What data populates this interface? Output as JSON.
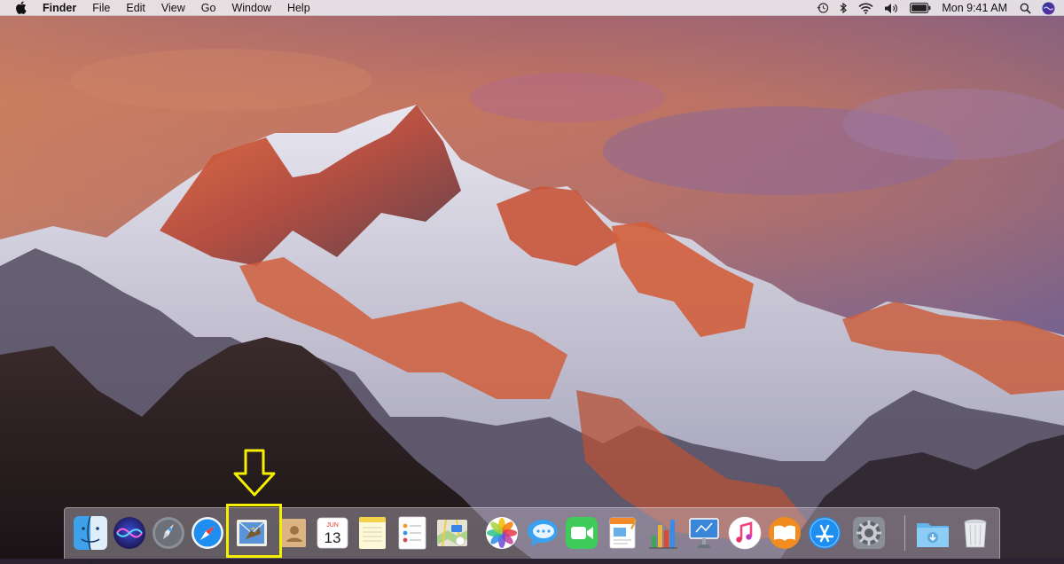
{
  "menubar": {
    "apple_menu": "apple-logo-icon",
    "app_name": "Finder",
    "menus": [
      "File",
      "Edit",
      "View",
      "Go",
      "Window",
      "Help"
    ],
    "status_icons": [
      "time-machine-icon",
      "bluetooth-icon",
      "wifi-icon",
      "volume-icon",
      "battery-icon"
    ],
    "clock": "Mon 9:41 AM",
    "spotlight": "search-icon",
    "siri": "siri-icon"
  },
  "wallpaper": {
    "description_colors": {
      "sky_top": "#a86a6e",
      "sky_mid": "#c47a63",
      "dusk_purple": "#6f5a87",
      "rock_glow": "#e0673a"
    }
  },
  "dock": {
    "items": [
      {
        "name": "Finder",
        "icon": "finder-icon",
        "running": true
      },
      {
        "name": "Siri",
        "icon": "siri-icon",
        "running": false
      },
      {
        "name": "Launchpad",
        "icon": "launchpad-icon",
        "running": false
      },
      {
        "name": "Safari",
        "icon": "safari-icon",
        "running": false
      },
      {
        "name": "Mail",
        "icon": "mail-icon",
        "running": false,
        "highlighted": true
      },
      {
        "name": "Contacts",
        "icon": "contacts-icon",
        "running": false
      },
      {
        "name": "Calendar",
        "icon": "calendar-icon",
        "running": false,
        "month": "JUN",
        "day": "13"
      },
      {
        "name": "Notes",
        "icon": "notes-icon",
        "running": false
      },
      {
        "name": "Reminders",
        "icon": "reminders-icon",
        "running": false
      },
      {
        "name": "Maps",
        "icon": "maps-icon",
        "running": false
      },
      {
        "name": "Photos",
        "icon": "photos-icon",
        "running": false
      },
      {
        "name": "Messages",
        "icon": "messages-icon",
        "running": false
      },
      {
        "name": "FaceTime",
        "icon": "facetime-icon",
        "running": false
      },
      {
        "name": "Pages",
        "icon": "pages-icon",
        "running": false
      },
      {
        "name": "Numbers",
        "icon": "numbers-icon",
        "running": false
      },
      {
        "name": "Keynote",
        "icon": "keynote-icon",
        "running": false
      },
      {
        "name": "iTunes",
        "icon": "itunes-icon",
        "running": false
      },
      {
        "name": "iBooks",
        "icon": "ibooks-icon",
        "running": false
      },
      {
        "name": "App Store",
        "icon": "app-store-icon",
        "running": false
      },
      {
        "name": "System Preferences",
        "icon": "system-preferences-icon",
        "running": false
      },
      {
        "name": "Downloads",
        "icon": "downloads-folder-icon",
        "running": false
      },
      {
        "name": "Trash",
        "icon": "trash-icon",
        "running": false
      }
    ]
  },
  "annotation": {
    "highlight_color": "#f4f000",
    "target": "Mail"
  }
}
